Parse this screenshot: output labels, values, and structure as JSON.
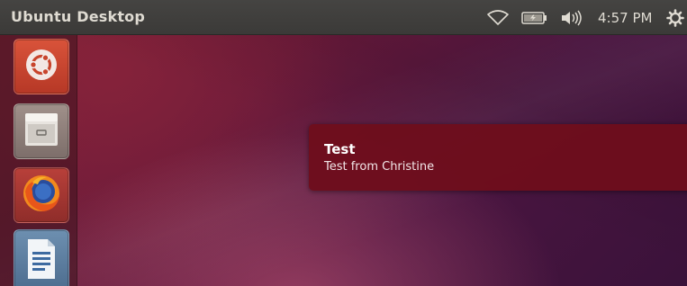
{
  "panel": {
    "title": "Ubuntu Desktop",
    "clock": "4:57 PM",
    "indicators": [
      "wifi-icon",
      "battery-icon",
      "volume-icon",
      "gear-icon"
    ]
  },
  "launcher": {
    "items": [
      {
        "name": "Dash",
        "icon": "ubuntu-logo-icon"
      },
      {
        "name": "Files",
        "icon": "file-cabinet-icon"
      },
      {
        "name": "Firefox",
        "icon": "firefox-icon"
      },
      {
        "name": "LibreOffice Writer",
        "icon": "document-icon"
      }
    ]
  },
  "notification": {
    "title": "Test",
    "body": "Test from Christine"
  },
  "colors": {
    "panel": "#3b3a38",
    "notification": "#6e0e1c",
    "wallpaper": "#6a1a3a"
  }
}
